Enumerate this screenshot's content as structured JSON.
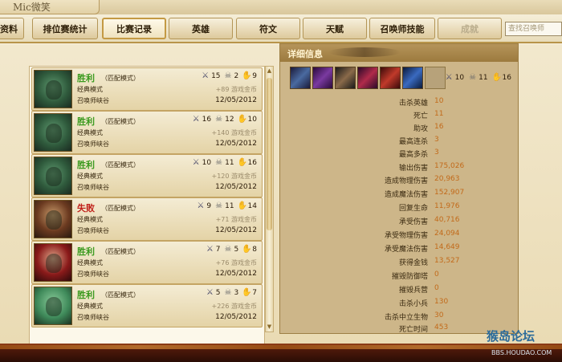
{
  "window": {
    "title": "Mic微笑"
  },
  "nav": {
    "tabs": [
      {
        "label": "资料"
      },
      {
        "label": "排位赛统计"
      },
      {
        "label": "比赛记录",
        "active": true
      },
      {
        "label": "英雄"
      },
      {
        "label": "符文"
      },
      {
        "label": "天赋"
      },
      {
        "label": "召唤师技能"
      },
      {
        "label": "成就",
        "disabled": true
      }
    ],
    "search_placeholder": "查找召唤师"
  },
  "matches": [
    {
      "result": "胜利",
      "result_type": "win",
      "mode": "（匹配模式）",
      "map_type": "经典模式",
      "map": "召唤师峡谷",
      "kills": "15",
      "deaths": "2",
      "assists": "9",
      "gold": "+89 游戏金币",
      "date": "12/05/2012",
      "champion_icon": "zombie-champion-portrait"
    },
    {
      "result": "胜利",
      "result_type": "win",
      "mode": "（匹配模式）",
      "map_type": "经典模式",
      "map": "召唤师峡谷",
      "kills": "16",
      "deaths": "12",
      "assists": "10",
      "gold": "+140 游戏金币",
      "date": "12/05/2012",
      "champion_icon": "zombie-champion-portrait"
    },
    {
      "result": "胜利",
      "result_type": "win",
      "mode": "（匹配模式）",
      "map_type": "经典模式",
      "map": "召唤师峡谷",
      "kills": "10",
      "deaths": "11",
      "assists": "16",
      "gold": "+120 游戏金币",
      "date": "12/05/2012",
      "champion_icon": "zombie-champion-portrait"
    },
    {
      "result": "失败",
      "result_type": "loss",
      "mode": "（匹配模式）",
      "map_type": "经典模式",
      "map": "召唤师峡谷",
      "kills": "9",
      "deaths": "11",
      "assists": "14",
      "gold": "+71 游戏金币",
      "date": "12/05/2012",
      "champion_icon": "gunner-champion-portrait"
    },
    {
      "result": "胜利",
      "result_type": "win",
      "mode": "（匹配模式）",
      "map_type": "经典模式",
      "map": "召唤师峡谷",
      "kills": "7",
      "deaths": "5",
      "assists": "8",
      "gold": "+76 游戏金币",
      "date": "12/05/2012",
      "champion_icon": "redhead-champion-portrait"
    },
    {
      "result": "胜利",
      "result_type": "win",
      "mode": "（匹配模式）",
      "map_type": "经典模式",
      "map": "召唤师峡谷",
      "kills": "5",
      "deaths": "3",
      "assists": "7",
      "gold": "+226 游戏金币",
      "date": "12/05/2012",
      "champion_icon": "mummy-champion-portrait"
    }
  ],
  "details": {
    "title": "详细信息",
    "kills": "10",
    "deaths": "11",
    "assists": "16",
    "items": [
      "sword-item-icon",
      "claw-item-icon",
      "orb-item-icon",
      "blade-item-icon",
      "boots-item-icon",
      "hat-item-icon",
      "empty-slot"
    ],
    "stats": [
      {
        "label": "击杀英雄",
        "value": "10"
      },
      {
        "label": "死亡",
        "value": "11"
      },
      {
        "label": "助攻",
        "value": "16"
      },
      {
        "label": "最高连杀",
        "value": "3"
      },
      {
        "label": "最高多杀",
        "value": "3"
      },
      {
        "label": "输出伤害",
        "value": "175,026"
      },
      {
        "label": "造成物理伤害",
        "value": "20,963"
      },
      {
        "label": "造成魔法伤害",
        "value": "152,907"
      },
      {
        "label": "回复生命",
        "value": "11,976"
      },
      {
        "label": "承受伤害",
        "value": "40,716"
      },
      {
        "label": "承受物理伤害",
        "value": "24,094"
      },
      {
        "label": "承受魔法伤害",
        "value": "14,649"
      },
      {
        "label": "获得金钱",
        "value": "13,527"
      },
      {
        "label": "摧毁防御塔",
        "value": "0"
      },
      {
        "label": "摧毁兵营",
        "value": "0"
      },
      {
        "label": "击杀小兵",
        "value": "130"
      },
      {
        "label": "击杀中立生物",
        "value": "30"
      },
      {
        "label": "死亡时间",
        "value": "453"
      }
    ]
  },
  "watermark": {
    "brand": "猴岛论坛",
    "url": "BBS.HOUDAO.COM"
  },
  "colors": {
    "win": "#3a9a1e",
    "loss": "#c0201a",
    "stat_value": "#c26a1a",
    "accent": "#b8944a"
  }
}
